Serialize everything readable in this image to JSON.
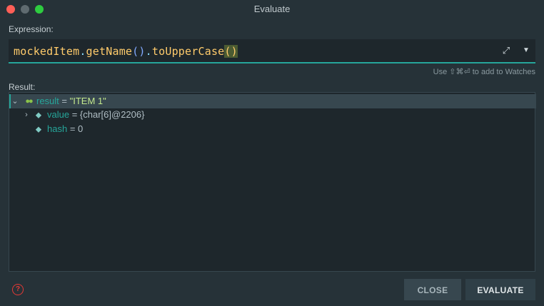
{
  "window": {
    "title": "Evaluate"
  },
  "expression": {
    "label": "Expression:",
    "tokens": {
      "var": "mockedItem",
      "dot1": ".",
      "method1": "getName",
      "parens1": "()",
      "dot2": ".",
      "method2": "toUpperCase",
      "parens2": "()"
    },
    "hint": "Use ⇧⌘⏎ to add to Watches"
  },
  "result": {
    "label": "Result:",
    "rows": [
      {
        "name": "result",
        "eq": " = ",
        "value": "\"ITEM 1\"",
        "expanded": true
      },
      {
        "name": "value",
        "eq": " = ",
        "value": "{char[6]@2206}",
        "expanded": false
      },
      {
        "name": "hash",
        "eq": " = ",
        "value": "0"
      }
    ]
  },
  "buttons": {
    "close": "CLOSE",
    "evaluate": "EVALUATE"
  },
  "icons": {
    "help": "help-icon",
    "expand": "expand-icon",
    "dropdown": "dropdown-icon",
    "watch": "glasses-icon",
    "field": "tag-icon"
  },
  "colors": {
    "background": "#263238",
    "accent": "#26a69a",
    "string": "#c3e88d",
    "help": "#e53935"
  }
}
